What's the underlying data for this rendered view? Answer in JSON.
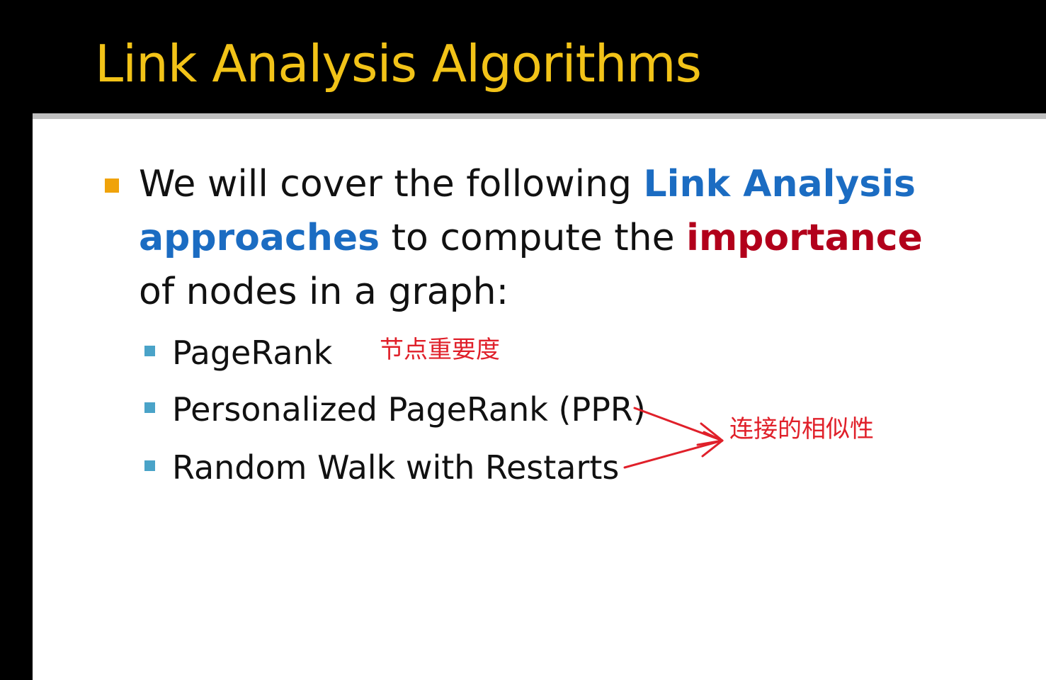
{
  "slide": {
    "title": "Link Analysis Algorithms",
    "intro": {
      "part1": "We will cover the following ",
      "highlight_blue": "Link Analysis approaches",
      "part2": " to compute the ",
      "highlight_red": "importance",
      "part3": " of nodes in a graph:"
    },
    "items": [
      "PageRank",
      "Personalized PageRank (PPR)",
      "Random Walk with Restarts"
    ],
    "annotations": {
      "node_importance": "节点重要度",
      "connection_similarity": "连接的相似性"
    }
  },
  "colors": {
    "title": "#f2c318",
    "highlight_blue": "#1b6cc2",
    "highlight_red": "#b2001b",
    "annotation": "#e0202a",
    "bullet_main": "#f0a30a",
    "bullet_sub": "#4aa3c8"
  }
}
